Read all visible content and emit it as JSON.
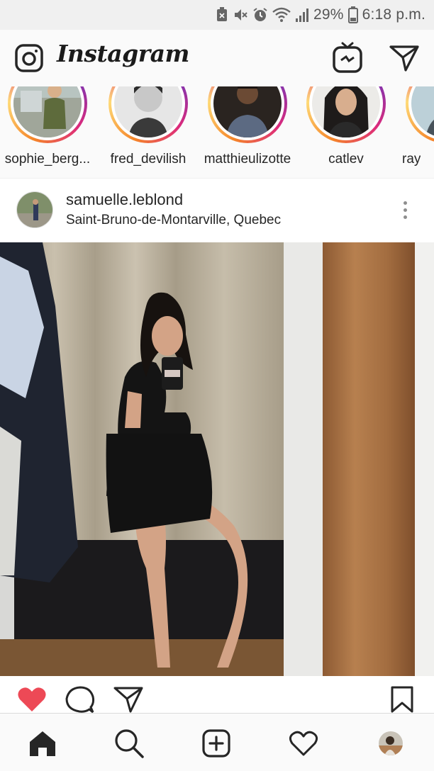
{
  "status_bar": {
    "battery_percent": "29%",
    "time": "6:18 p.m.",
    "icons": [
      "nfc-icon",
      "mute-icon",
      "alarm-icon",
      "wifi-icon",
      "signal-icon",
      "battery-icon"
    ]
  },
  "header": {
    "brand": "Instagram",
    "icons": [
      "camera-icon",
      "igtv-icon",
      "direct-message-icon"
    ]
  },
  "stories": [
    {
      "username": "sophie_berg..."
    },
    {
      "username": "fred_devilish"
    },
    {
      "username": "matthieulizotte"
    },
    {
      "username": "catlev"
    },
    {
      "username": "ray"
    }
  ],
  "post": {
    "username": "samuelle.leblond",
    "location": "Saint-Bruno-de-Montarville, Quebec",
    "liked": true,
    "colors": {
      "like": "#ed4956"
    },
    "icons": [
      "heart-icon",
      "comment-icon",
      "share-icon",
      "bookmark-icon",
      "more-options-icon"
    ]
  },
  "bottom_nav": {
    "icons": [
      "home-icon",
      "search-icon",
      "new-post-icon",
      "activity-icon",
      "profile-avatar"
    ]
  }
}
